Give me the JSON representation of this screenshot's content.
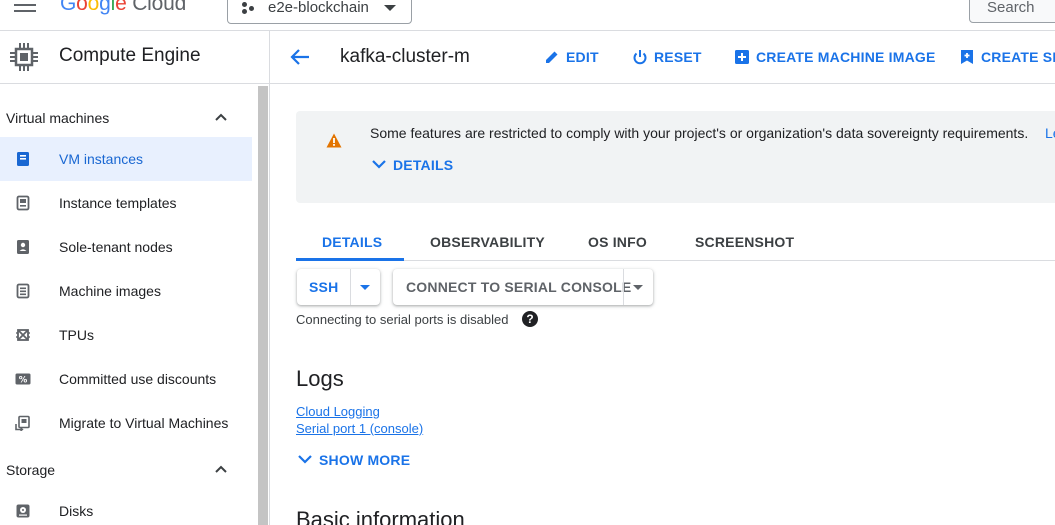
{
  "header": {
    "logo_parts": [
      "G",
      "o",
      "o",
      "g",
      "l",
      "e"
    ],
    "logo_cloud": "Cloud",
    "project_name": "e2e-blockchain",
    "search_placeholder": "Search"
  },
  "sidebar": {
    "product_title": "Compute Engine",
    "sections": [
      {
        "title": "Virtual machines",
        "items": [
          {
            "label": "VM instances",
            "icon": "vm-instances-icon",
            "active": true
          },
          {
            "label": "Instance templates",
            "icon": "instance-templates-icon",
            "active": false
          },
          {
            "label": "Sole-tenant nodes",
            "icon": "sole-tenant-nodes-icon",
            "active": false
          },
          {
            "label": "Machine images",
            "icon": "machine-images-icon",
            "active": false
          },
          {
            "label": "TPUs",
            "icon": "tpus-icon",
            "active": false
          },
          {
            "label": "Committed use discounts",
            "icon": "committed-use-discounts-icon",
            "active": false
          },
          {
            "label": "Migrate to Virtual Machines",
            "icon": "migrate-icon",
            "active": false
          }
        ]
      },
      {
        "title": "Storage",
        "items": [
          {
            "label": "Disks",
            "icon": "disks-icon",
            "active": false
          }
        ]
      }
    ]
  },
  "instance": {
    "title": "kafka-cluster-m",
    "actions": [
      {
        "label": "EDIT",
        "icon": "pencil-icon"
      },
      {
        "label": "RESET",
        "icon": "power-icon"
      },
      {
        "label": "CREATE MACHINE IMAGE",
        "icon": "add-box-icon"
      },
      {
        "label": "CREATE SIM",
        "icon": "bookmark-add-icon"
      }
    ]
  },
  "banner": {
    "text": "Some features are restricted to comply with your project's or organization's data sovereignty requirements.",
    "link_text": "Le",
    "details_label": "DETAILS"
  },
  "tabs": [
    {
      "label": "DETAILS",
      "active": true
    },
    {
      "label": "OBSERVABILITY",
      "active": false
    },
    {
      "label": "OS INFO",
      "active": false
    },
    {
      "label": "SCREENSHOT",
      "active": false
    }
  ],
  "connect": {
    "ssh_label": "SSH",
    "serial_label": "CONNECT TO SERIAL CONSOLE",
    "serial_note": "Connecting to serial ports is disabled",
    "help_glyph": "?"
  },
  "logs": {
    "heading": "Logs",
    "links": [
      "Cloud Logging",
      "Serial port 1 (console)"
    ],
    "show_more_label": "SHOW MORE"
  },
  "basic_info": {
    "heading": "Basic information"
  },
  "colors": {
    "accent": "#1a73e8",
    "active_nav_bg": "#e8f0fe",
    "warning": "#e37400",
    "banner_bg": "#f1f3f4"
  }
}
